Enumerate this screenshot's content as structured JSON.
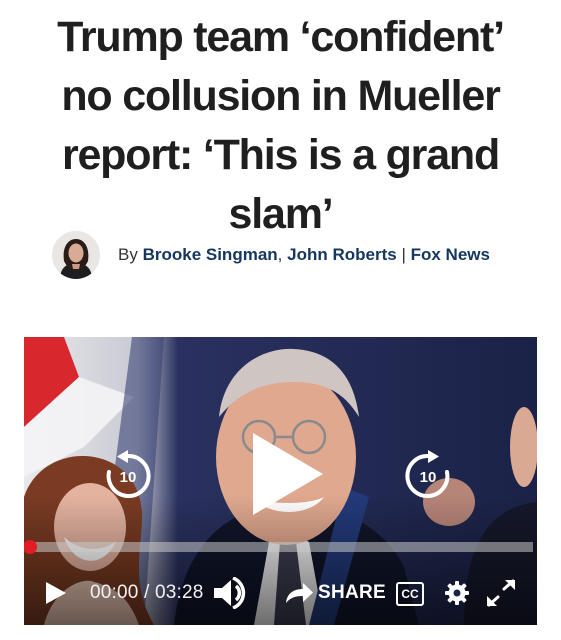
{
  "article": {
    "headline": "Trump team ‘confident’ no collusion in Mueller report: ‘This is a grand slam’",
    "byline": {
      "prefix": "By",
      "author1": "Brooke Singman",
      "comma": ",",
      "author2": "John Roberts",
      "separator": "|",
      "source": "Fox News"
    }
  },
  "video": {
    "current_time": "00:00",
    "time_separator": "/",
    "duration": "03:28",
    "progress_fraction": 0,
    "skip_back_seconds": "10",
    "skip_forward_seconds": "10",
    "share_label": "SHARE",
    "cc_label": "CC"
  },
  "colors": {
    "headline": "#1f1f1f",
    "author_link": "#16365f",
    "progress_accent": "#e21c24",
    "player_bg": "#1c2246"
  },
  "icons": [
    "play-icon",
    "skip-back-10-icon",
    "skip-forward-10-icon",
    "volume-icon",
    "share-arrow-icon",
    "cc-icon",
    "gear-icon",
    "fullscreen-icon"
  ]
}
